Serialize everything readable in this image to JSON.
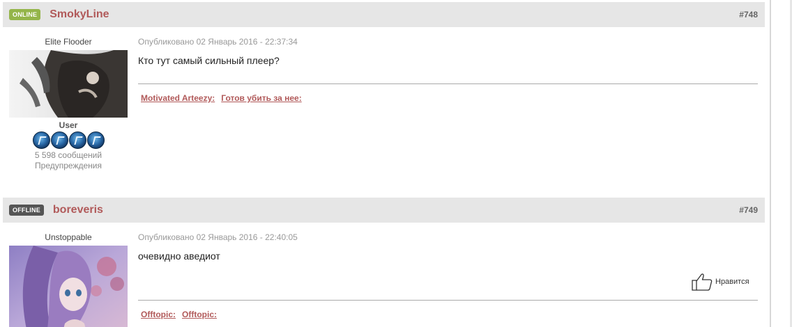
{
  "posts": [
    {
      "status": "ONLINE",
      "author": "SmokyLine",
      "number": "#748",
      "rank_title": "Elite Flooder",
      "group": "User",
      "message_count": "5 598 сообщений",
      "warnings": "Предупреждения",
      "posted": "Опубликовано 02 Январь 2016 - 22:37:34",
      "text": "Кто тут самый сильный плеер?",
      "signature": [
        "Motivated Arteezy:",
        "Готов убить за нее:"
      ]
    },
    {
      "status": "OFFLINE",
      "author": "boreveris",
      "number": "#749",
      "rank_title": "Unstoppable",
      "posted": "Опубликовано 02 Январь 2016 - 22:40:05",
      "text": "очевидно аведиот",
      "like_label": "Нравится",
      "signature": [
        "Offtopic:",
        "Offtopic:"
      ]
    }
  ],
  "colors": {
    "accent": "#b15a5a",
    "online": "#94b54a",
    "offline": "#555555",
    "header_bg": "#e6e6e6"
  }
}
